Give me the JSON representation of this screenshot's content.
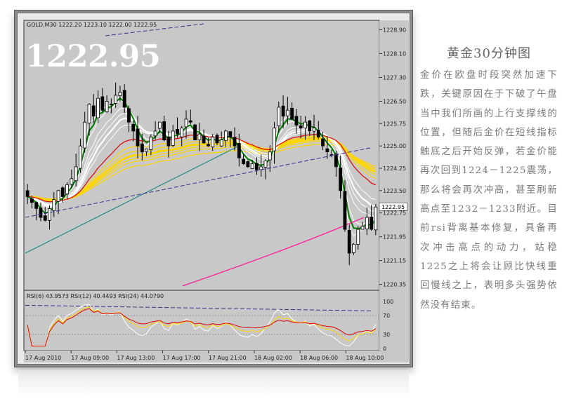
{
  "side_panel": {
    "title": "黄金30分钟图",
    "body": "金价在欧盘时段突然加速下跌，关键原因在于下破了午盘当中我们所画的上行支撑线的位置，但随后金价在短线指标触底之后开始反弹，若金价能再次回到1224－1225震荡，那么将会再次冲高，甚至刷新高点至1232－1233附近。目前rsi背离基本修复，具备再次冲击高点的动力，站稳1225之上将会让顾比快线重回慢线之上，表明多头强势依然没有结束。"
  },
  "chart_data": [
    {
      "type": "candlestick",
      "header": "GOLD,M30  1222.20 1223.10 1222.00 1222.95",
      "big_price": "1222.95",
      "current_price_label": "1222.95",
      "ylim": [
        1220.2,
        1229.1
      ],
      "y_ticks": [
        "1228.90",
        "1228.10",
        "1227.30",
        "1226.50",
        "1225.75",
        "1225.00",
        "1224.25",
        "1223.50",
        "1222.75",
        "1221.95",
        "1221.15",
        "1220.35"
      ],
      "x_ticks": [
        "17 Aug 2010",
        "17 Aug 09:00",
        "17 Aug 13:00",
        "17 Aug 17:00",
        "17 Aug 21:00",
        "18 Aug 02:00",
        "18 Aug 06:00",
        "18 Aug 10:00"
      ],
      "grid": false,
      "colors": {
        "background": "#c8c8c8",
        "up": "#ffffff",
        "down": "#000000",
        "ma_fast": "#ffffff",
        "ma_slow": "#ffd700",
        "ma_green": "#008000",
        "ma_red": "#dd0000",
        "ma_magenta": "#ff1493",
        "ma_teal": "#008080",
        "trend": "#3d2d8c"
      },
      "close": [
        1223.3,
        1223.1,
        1222.9,
        1222.6,
        1222.5,
        1222.9,
        1223.2,
        1223.5,
        1223.3,
        1223.7,
        1223.9,
        1224.3,
        1225.0,
        1225.8,
        1226.4,
        1226.0,
        1226.6,
        1226.2,
        1226.5,
        1226.4,
        1226.7,
        1226.8,
        1226.3,
        1225.8,
        1225.5,
        1225.0,
        1224.8,
        1224.9,
        1225.3,
        1225.5,
        1225.8,
        1225.2,
        1225.0,
        1225.5,
        1225.4,
        1225.6,
        1225.9,
        1225.8,
        1225.2,
        1225.4,
        1225.1,
        1225.0,
        1225.3,
        1225.1,
        1225.2,
        1225.5,
        1225.3,
        1225.0,
        1224.6,
        1224.4,
        1224.3,
        1224.4,
        1224.2,
        1224.3,
        1224.5,
        1224.8,
        1225.6,
        1226.3,
        1226.0,
        1226.2,
        1225.9,
        1225.7,
        1225.6,
        1225.8,
        1225.5,
        1225.6,
        1225.3,
        1225.0,
        1224.8,
        1224.7,
        1224.3,
        1223.5,
        1222.2,
        1221.4,
        1221.7,
        1222.2,
        1222.3,
        1222.6,
        1222.2,
        1222.95
      ],
      "highs": [
        1224.4,
        1228.4
      ],
      "lows": [
        1222.4,
        1220.4
      ],
      "rsi": {
        "header": "RSI(6) 43.9573  RSI(12) 40.4493  RSI(24) 44.0790",
        "ylim": [
          0,
          100
        ],
        "y_ticks": [
          "100",
          "70",
          "30",
          "0"
        ],
        "levels": [
          70,
          30
        ],
        "series": [
          {
            "name": "RSI(6)",
            "color": "#ffffff"
          },
          {
            "name": "RSI(12)",
            "color": "#ffd700"
          },
          {
            "name": "RSI(24)",
            "color": "#dd0000"
          }
        ]
      }
    }
  ]
}
